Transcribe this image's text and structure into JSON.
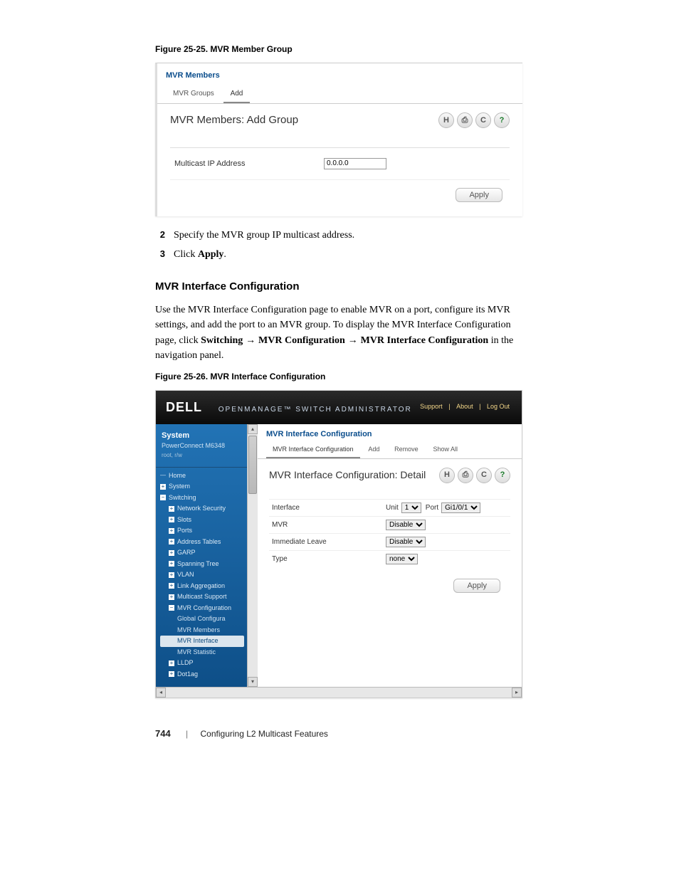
{
  "fig1": {
    "caption": "Figure 25-25.    MVR Member Group"
  },
  "s1": {
    "header_title": "MVR Members",
    "tab_mvr_groups": "MVR Groups",
    "tab_add": "Add",
    "subtitle": "MVR Members: Add Group",
    "multicast_label": "Multicast IP Address",
    "multicast_value": "0.0.0.0",
    "apply": "Apply"
  },
  "steps": {
    "n2": "2",
    "t2": "Specify the MVR group IP multicast address.",
    "n3": "3",
    "t3_a": "Click ",
    "t3_b": "Apply",
    "t3_c": "."
  },
  "h3": "MVR Interface Configuration",
  "para": {
    "a": "Use the MVR Interface Configuration page to enable MVR on a port, configure its MVR settings, and add the port to an MVR group. To display the MVR Interface Configuration page, click ",
    "b": "Switching",
    "c": " → ",
    "d": "MVR Configuration",
    "e": " → ",
    "f": "MVR Interface Configuration",
    "g": " in the navigation panel."
  },
  "fig2": {
    "caption": "Figure 25-26.    MVR Interface Configuration"
  },
  "s2": {
    "brand": "DELL",
    "brand_suffix": "OPENMANAGE™  SWITCH  ADMINISTRATOR",
    "toplinks": {
      "support": "Support",
      "about": "About",
      "logout": "Log Out",
      "sep": "|"
    },
    "side": {
      "title": "System",
      "dev": "PowerConnect M6348",
      "usr": "root, r/w",
      "home": "Home",
      "system": "System",
      "switching": "Switching",
      "netsec": "Network Security",
      "slots": "Slots",
      "ports": "Ports",
      "addr": "Address Tables",
      "garp": "GARP",
      "stp": "Spanning Tree",
      "vlan": "VLAN",
      "lag": "Link Aggregation",
      "mcast": "Multicast Support",
      "mvrconf": "MVR Configuration",
      "global": "Global Configura",
      "members": "MVR Members",
      "mvriface": "MVR Interface",
      "mvrstat": "MVR Statistic",
      "lldp": "LLDP",
      "dot1ag": "Dot1ag"
    },
    "content": {
      "header": "MVR Interface Configuration",
      "tab_detail": "MVR Interface Configuration",
      "tab_add": "Add",
      "tab_remove": "Remove",
      "tab_showall": "Show All",
      "subtitle": "MVR Interface Configuration: Detail",
      "row_iface": "Interface",
      "unit_label": "Unit",
      "unit_value": "1",
      "port_label": "Port",
      "port_value": "Gi1/0/1",
      "row_mvr": "MVR",
      "mvr_value": "Disable",
      "row_imm": "Immediate Leave",
      "imm_value": "Disable",
      "row_type": "Type",
      "type_value": "none",
      "apply": "Apply"
    }
  },
  "icons": {
    "save": "H",
    "print": "⎙",
    "refresh": "C",
    "help": "?"
  },
  "footer": {
    "page": "744",
    "chapter": "Configuring L2 Multicast Features"
  }
}
